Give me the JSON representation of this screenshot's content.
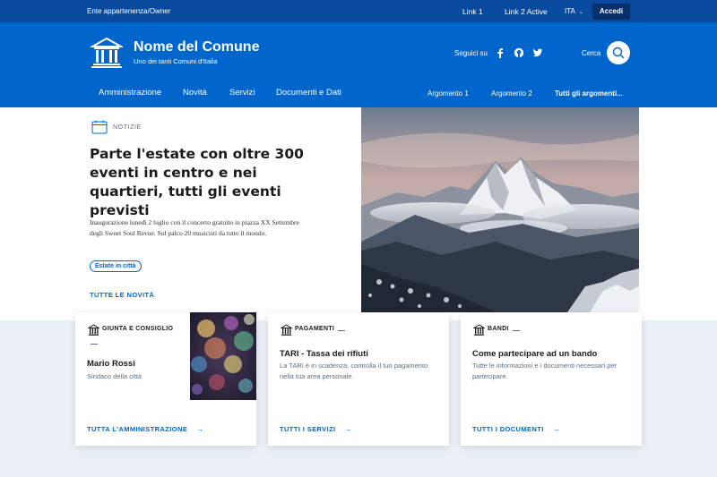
{
  "slim": {
    "owner": "Ente appartenenza/Owner",
    "link1": "Link 1",
    "link2": "Link 2 Active",
    "lang": "ITA",
    "login": "Accedi"
  },
  "brand": {
    "title": "Nome del Comune",
    "subtitle": "Uno dei tanti Comuni d'Italia"
  },
  "social": {
    "label": "Seguici su",
    "icons": [
      "facebook-icon",
      "github-icon",
      "twitter-icon"
    ]
  },
  "search": {
    "label": "Cerca"
  },
  "nav": {
    "main": [
      "Amministrazione",
      "Novità",
      "Servizi",
      "Documenti e Dati"
    ],
    "topics": [
      "Argomento 1",
      "Argomento 2",
      "Tutti gli argomenti..."
    ]
  },
  "hero": {
    "category": "NOTIZIE",
    "title": "Parte l'estate con oltre 300 eventi in centro e nei quartieri, tutti gli eventi previsti",
    "text": "Inaugurazione lunedì 2 luglio con il concerto gratuito in piazza XX Settembre degli Sweet Soul Revue. Sul palco 20 musicisti da tutto il mondo.",
    "chip": "Estate in città",
    "link": "TUTTE LE NOVITÀ"
  },
  "cards": [
    {
      "category": "GIUNTA E CONSIGLIO",
      "title": "Mario Rossi",
      "text": "Sindaco della città",
      "link": "TUTTA L'AMMINISTRAZIONE"
    },
    {
      "category": "PAGAMENTI",
      "title": "TARI - Tassa dei rifiuti",
      "text": "La TARI è in scadenza, controlla il tuo pagamento nella tua area personale.",
      "link": "TUTTI I SERVIZI"
    },
    {
      "category": "BANDI",
      "title": "Come partecipare ad un bando",
      "text": "Tutte le informazioni e i documenti necessari per partecipare.",
      "link": "TUTTI I DOCUMENTI"
    }
  ],
  "colors": {
    "primary": "#0066cc",
    "slim_bg": "#0a4a9e",
    "accedi_bg": "#08306b",
    "lower_bg": "#eaf0f6"
  }
}
